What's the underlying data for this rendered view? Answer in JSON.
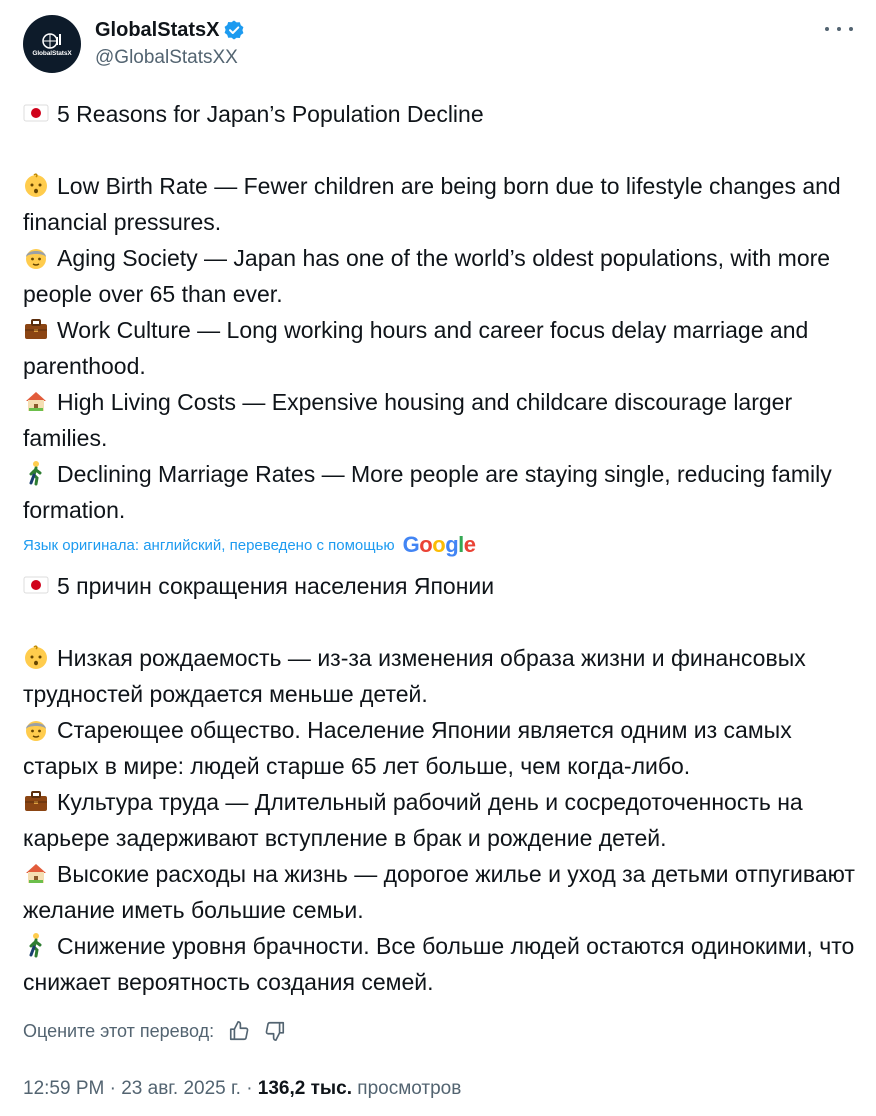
{
  "author": {
    "display_name": "GlobalStatsX",
    "handle": "@GlobalStatsXX",
    "avatar_text": "GlobalStatsX"
  },
  "post_en": {
    "title": "5 Reasons for Japan’s Population Decline",
    "items": [
      {
        "icon": "baby-emoji",
        "text": "Low Birth Rate — Fewer children are being born due to lifestyle changes and financial pressures."
      },
      {
        "icon": "older-person-emoji",
        "text": "Aging Society — Japan has one of the world’s oldest populations, with more people over 65 than ever."
      },
      {
        "icon": "briefcase-emoji",
        "text": "Work Culture — Long working hours and career focus delay marriage and parenthood."
      },
      {
        "icon": "house-emoji",
        "text": "High Living Costs — Expensive housing and childcare discourage larger families."
      },
      {
        "icon": "person-walking-emoji",
        "text": "Declining Marriage Rates — More people are staying single, reducing family formation."
      }
    ]
  },
  "translation": {
    "note": "Язык оригинала: английский, переведено с помощью",
    "provider": "Google"
  },
  "post_ru": {
    "title": "5 причин сокращения населения Японии",
    "items": [
      {
        "icon": "baby-emoji",
        "text": "Низкая рождаемость — из-за изменения образа жизни и финансовых трудностей рождается меньше детей."
      },
      {
        "icon": "older-person-emoji",
        "text": "Стареющее общество. Население Японии является одним из самых старых в мире: людей старше 65 лет больше, чем когда-либо."
      },
      {
        "icon": "briefcase-emoji",
        "text": "Культура труда — Длительный рабочий день и сосредоточенность на карьере задерживают вступление в брак и рождение детей."
      },
      {
        "icon": "house-emoji",
        "text": "Высокие расходы на жизнь — дорогое жилье и уход за детьми отпугивают желание иметь большие семьи."
      },
      {
        "icon": "person-walking-emoji",
        "text": "Снижение уровня брачности. Все больше людей остаются одинокими, что снижает вероятность создания семей."
      }
    ]
  },
  "rate_translation": {
    "label": "Оцените этот перевод:"
  },
  "meta": {
    "time": "12:59 PM",
    "sep": "·",
    "date": "23 авг. 2025 г.",
    "views_count": "136,2 тыс.",
    "views_label": "просмотров"
  },
  "colors": {
    "text": "#0f1419",
    "muted": "#536471",
    "link": "#1d9bf0",
    "verified": "#1d9bf0"
  }
}
